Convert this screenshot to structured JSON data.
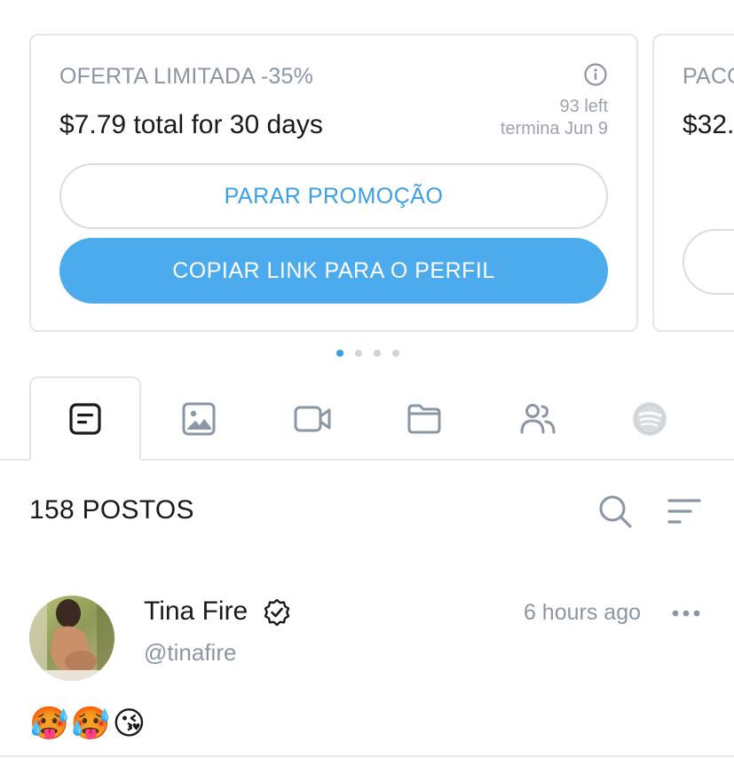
{
  "promos": [
    {
      "kicker": "OFERTA LIMITADA -35%",
      "price": "$7.79 total for 30 days",
      "left": "93 left",
      "ends": "termina Jun 9",
      "stop_label": "PARAR PROMOÇÃO",
      "copy_label": "COPIAR LINK PARA O PERFIL"
    },
    {
      "kicker": "PACO",
      "price": "$32."
    }
  ],
  "pagination": {
    "total": 4,
    "active": 0
  },
  "tabs": [
    {
      "icon": "posts-icon",
      "active": true
    },
    {
      "icon": "image-icon",
      "active": false
    },
    {
      "icon": "video-icon",
      "active": false
    },
    {
      "icon": "folder-icon",
      "active": false
    },
    {
      "icon": "users-icon",
      "active": false
    },
    {
      "icon": "spotify-icon",
      "active": false
    }
  ],
  "posts_header": {
    "count_label": "158 POSTOS"
  },
  "post": {
    "author_name": "Tina Fire",
    "handle": "@tinafire",
    "time": "6 hours ago",
    "text": "🥵🥵😘"
  },
  "colors": {
    "accent": "#4cabec",
    "accent_text": "#3aa0e6",
    "muted": "#8a96a3",
    "border": "#e3e6ea",
    "icon": "#8a96a3"
  }
}
